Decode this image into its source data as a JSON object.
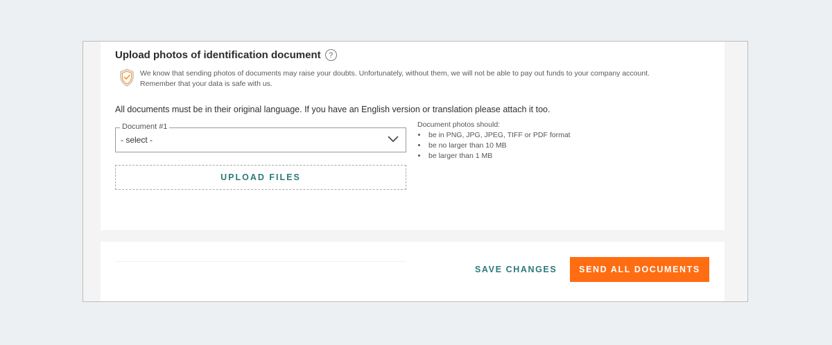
{
  "section": {
    "title": "Upload photos of identification document",
    "help_symbol": "?",
    "notice_line1": "We know that sending photos of documents may raise your doubts. Unfortunately, without them, we will not be able to pay out funds to your company account.",
    "notice_line2": "Remember that your data is safe with us.",
    "language_note": "All documents must be in their original language. If you have an English version or translation please attach it too."
  },
  "document_select": {
    "label": "Document #1",
    "value": "- select -"
  },
  "requirements": {
    "heading": "Document photos should:",
    "items": [
      "be in PNG, JPG, JPEG, TIFF or PDF format",
      "be no larger than 10 MB",
      "be larger than 1 MB"
    ]
  },
  "upload": {
    "label": "UPLOAD FILES"
  },
  "actions": {
    "save_label": "SAVE CHANGES",
    "send_label": "SEND ALL DOCUMENTS"
  },
  "colors": {
    "accent_teal": "#2b7a77",
    "primary_orange": "#ff6d13",
    "shield_orange": "#f39a3c"
  },
  "icons": {
    "help": "question-circle-icon",
    "notice": "shield-check-icon",
    "select": "chevron-down-icon"
  }
}
